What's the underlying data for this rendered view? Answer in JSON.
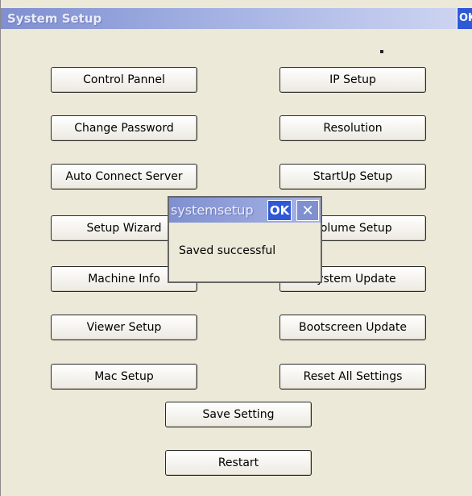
{
  "window": {
    "title": "System Setup",
    "ok_label": "OK"
  },
  "buttons": {
    "control_pannel": "Control Pannel",
    "ip_setup": "IP Setup",
    "change_password": "Change Password",
    "resolution": "Resolution",
    "auto_connect_server": "Auto Connect Server",
    "startup_setup": "StartUp Setup",
    "setup_wizard": "Setup Wizard",
    "volume_setup": "Volume Setup",
    "machine_info": "Machine Info",
    "system_update": "System Update",
    "viewer_setup": "Viewer Setup",
    "bootscreen_update": "Bootscreen Update",
    "mac_setup": "Mac Setup",
    "reset_all_settings": "Reset All Settings",
    "save_setting": "Save Setting",
    "restart": "Restart"
  },
  "dialog": {
    "title": "systemsetup",
    "ok_label": "OK",
    "close_icon": "close-icon",
    "message": "Saved successful"
  }
}
